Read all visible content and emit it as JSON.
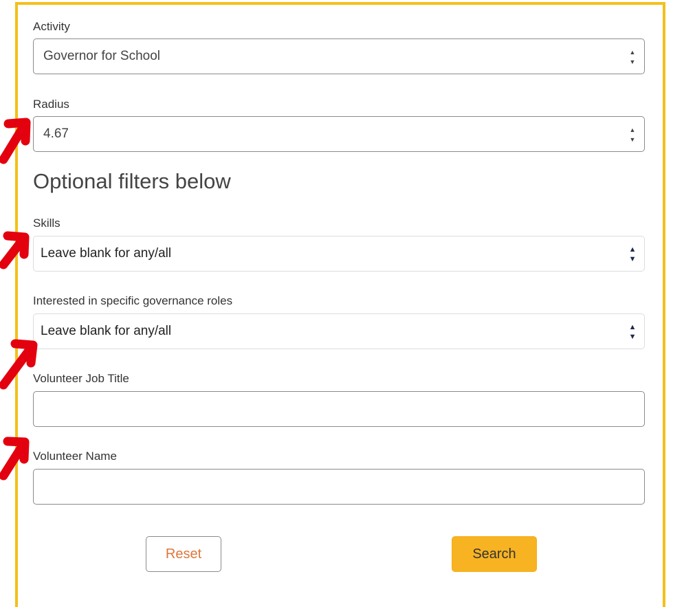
{
  "form": {
    "activity": {
      "label": "Activity",
      "value": "Governor for School"
    },
    "radius": {
      "label": "Radius",
      "value": "4.67"
    },
    "optional_heading": "Optional filters below",
    "skills": {
      "label": "Skills",
      "value": "Leave blank for any/all"
    },
    "governance_roles": {
      "label": "Interested in specific governance roles",
      "value": "Leave blank for any/all"
    },
    "job_title": {
      "label": "Volunteer Job Title",
      "value": ""
    },
    "volunteer_name": {
      "label": "Volunteer Name",
      "value": ""
    },
    "reset_label": "Reset",
    "search_label": "Search"
  },
  "colors": {
    "panel_border": "#f4c01a",
    "search_button": "#f7b321",
    "reset_text": "#e0763a",
    "annotation_arrow": "#e3000f"
  },
  "annotation": {
    "arrow_icon": "red-arrow-icon"
  }
}
